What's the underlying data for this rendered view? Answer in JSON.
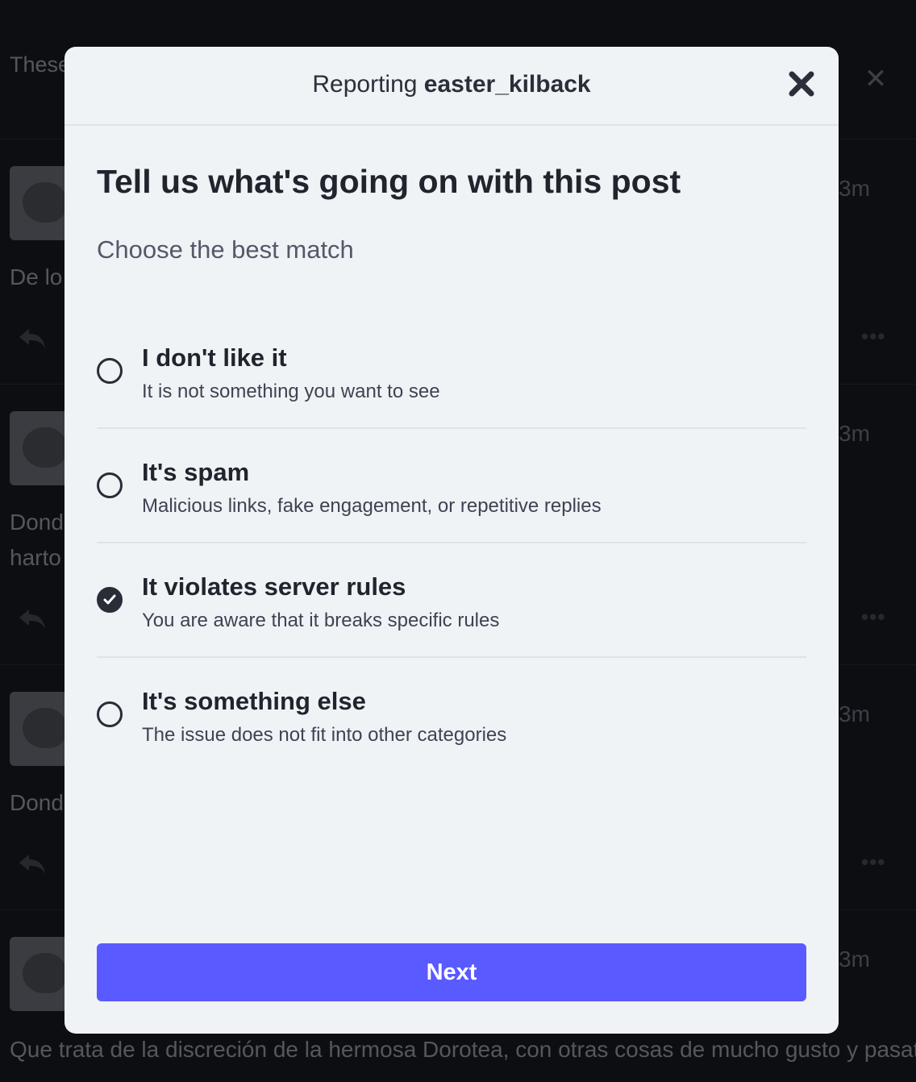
{
  "background": {
    "notice_text": "These server",
    "posts": [
      {
        "time": "3m",
        "content": "De lo"
      },
      {
        "time": "3m",
        "content": "Dond",
        "content2": "harto"
      },
      {
        "time": "3m",
        "content": "Dond"
      },
      {
        "time": "3m",
        "content": ""
      }
    ],
    "bottom_text": "Que trata de la discreción de la hermosa Dorotea, con otras cosas de mucho gusto y pasatiempo"
  },
  "modal": {
    "title_prefix": "Reporting ",
    "title_user": "easter_kilback",
    "heading": "Tell us what's going on with this post",
    "subheading": "Choose the best match",
    "options": [
      {
        "label": "I don't like it",
        "description": "It is not something you want to see",
        "checked": false
      },
      {
        "label": "It's spam",
        "description": "Malicious links, fake engagement, or repetitive replies",
        "checked": false
      },
      {
        "label": "It violates server rules",
        "description": "You are aware that it breaks specific rules",
        "checked": true
      },
      {
        "label": "It's something else",
        "description": "The issue does not fit into other categories",
        "checked": false
      }
    ],
    "next_label": "Next"
  },
  "colors": {
    "accent": "#595aff",
    "modal_bg": "#f0f3f6",
    "page_bg": "#191b22"
  }
}
